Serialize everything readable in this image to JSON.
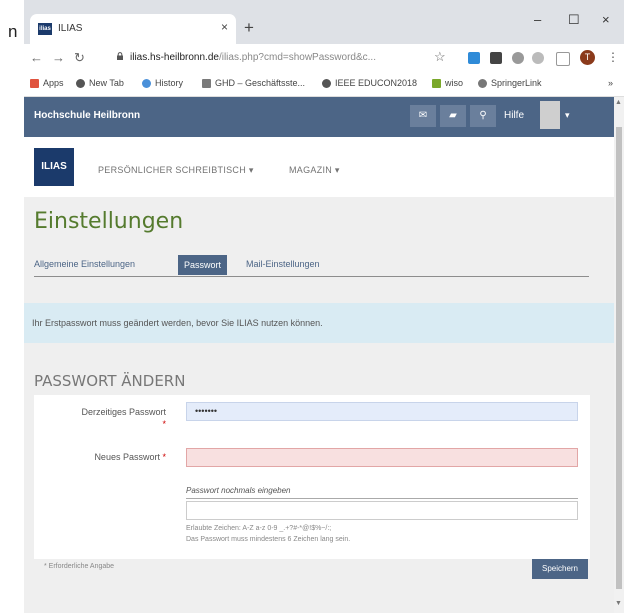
{
  "left_strip": {
    "partial_text": "n"
  },
  "browser": {
    "tab_title": "ILIAS",
    "tab_favicon_text": "ilias",
    "tab_close": "×",
    "new_tab": "+",
    "win_min": "–",
    "win_max": "☐",
    "win_close": "×",
    "url_host": "ilias.hs-heilbronn.de",
    "url_rest": "/ilias.php?cmd=showPassword&c...",
    "bookmarks": [
      {
        "label": "Apps",
        "color": "#e0533e"
      },
      {
        "label": "New Tab",
        "color": "#555555"
      },
      {
        "label": "History",
        "color": "#4a90d9"
      },
      {
        "label": "GHD – Geschäftsste...",
        "color": "#7a7a7a"
      },
      {
        "label": "IEEE EDUCON2018",
        "color": "#555555"
      },
      {
        "label": "wiso",
        "color": "#7aa82a"
      },
      {
        "label": "SpringerLink",
        "color": "#777777"
      }
    ],
    "bookmarks_more": "»",
    "profile_initial": "T",
    "menu_dots": "⋮"
  },
  "ilias": {
    "brand": "Hochschule Heilbronn",
    "help": "Hilfe",
    "logo": "ILIAS",
    "nav_items": [
      "PERSÖNLICHER SCHREIBTISCH ▾",
      "MAGAZIN ▾"
    ],
    "page_title": "Einstellungen",
    "subtabs": [
      "Allgemeine Einstellungen",
      "Passwort",
      "Mail-Einstellungen"
    ],
    "alert": "Ihr Erstpasswort muss geändert werden, bevor Sie ILIAS nutzen können.",
    "section_title": "PASSWORT ÄNDERN",
    "form": {
      "current_label": "Derzeitiges Passwort",
      "current_value": "•••••••",
      "new_label": "Neues Passwort",
      "repeat_label": "Passwort nochmals eingeben",
      "hint_chars": "Erlaubte Zeichen: A-Z a-z 0-9 _.+?#-*@!$%~/:;",
      "hint_length": "Das Passwort muss mindestens 6 Zeichen lang sein.",
      "required_mark": "*"
    },
    "required_note": "* Erforderliche Angabe",
    "save": "Speichern"
  }
}
